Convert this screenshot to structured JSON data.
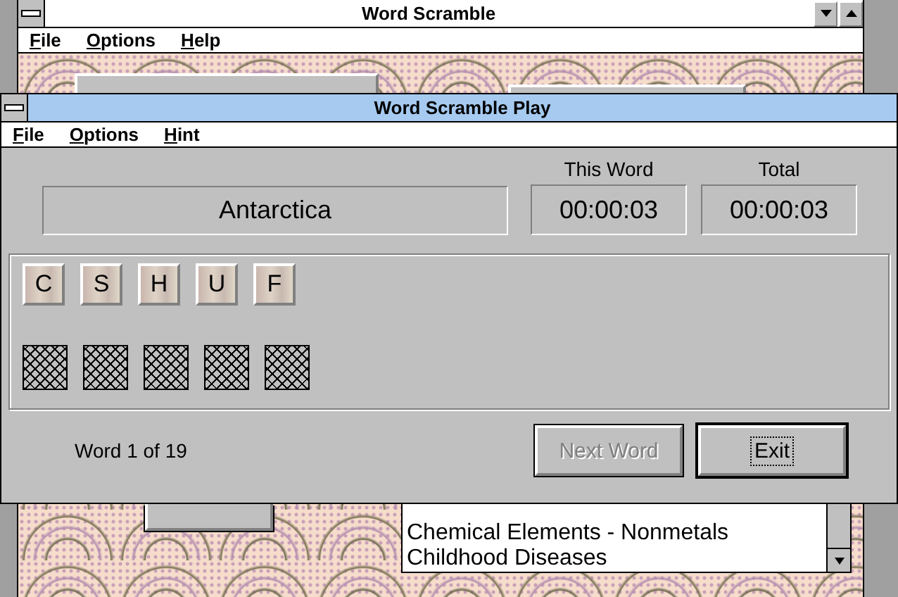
{
  "desktop_window": {
    "title": "Word Scramble",
    "active": false,
    "menu": [
      "File",
      "Options",
      "Help"
    ],
    "list": [
      "Chemical Elements - Nonmetals",
      "Childhood Diseases"
    ]
  },
  "play_window": {
    "title": "Word Scramble Play",
    "active": true,
    "menu": [
      "File",
      "Options",
      "Hint"
    ],
    "word": "Antarctica",
    "timers": [
      {
        "label": "This Word",
        "value": "00:00:03"
      },
      {
        "label": "Total",
        "value": "00:00:03"
      }
    ],
    "tiles": [
      {
        "letter": "C"
      },
      {
        "letter": "S"
      },
      {
        "letter": "H"
      },
      {
        "letter": "U"
      },
      {
        "letter": "F"
      }
    ],
    "slots": [
      {
        "kind": "empty"
      },
      {
        "kind": "empty"
      },
      {
        "kind": "empty"
      },
      {
        "kind": "empty"
      },
      {
        "kind": "empty"
      }
    ],
    "progress": "Word 1 of 19",
    "buttons": [
      {
        "label": "Next Word",
        "disabled": true,
        "default": false
      },
      {
        "label": "Exit",
        "disabled": false,
        "default": true
      }
    ]
  }
}
